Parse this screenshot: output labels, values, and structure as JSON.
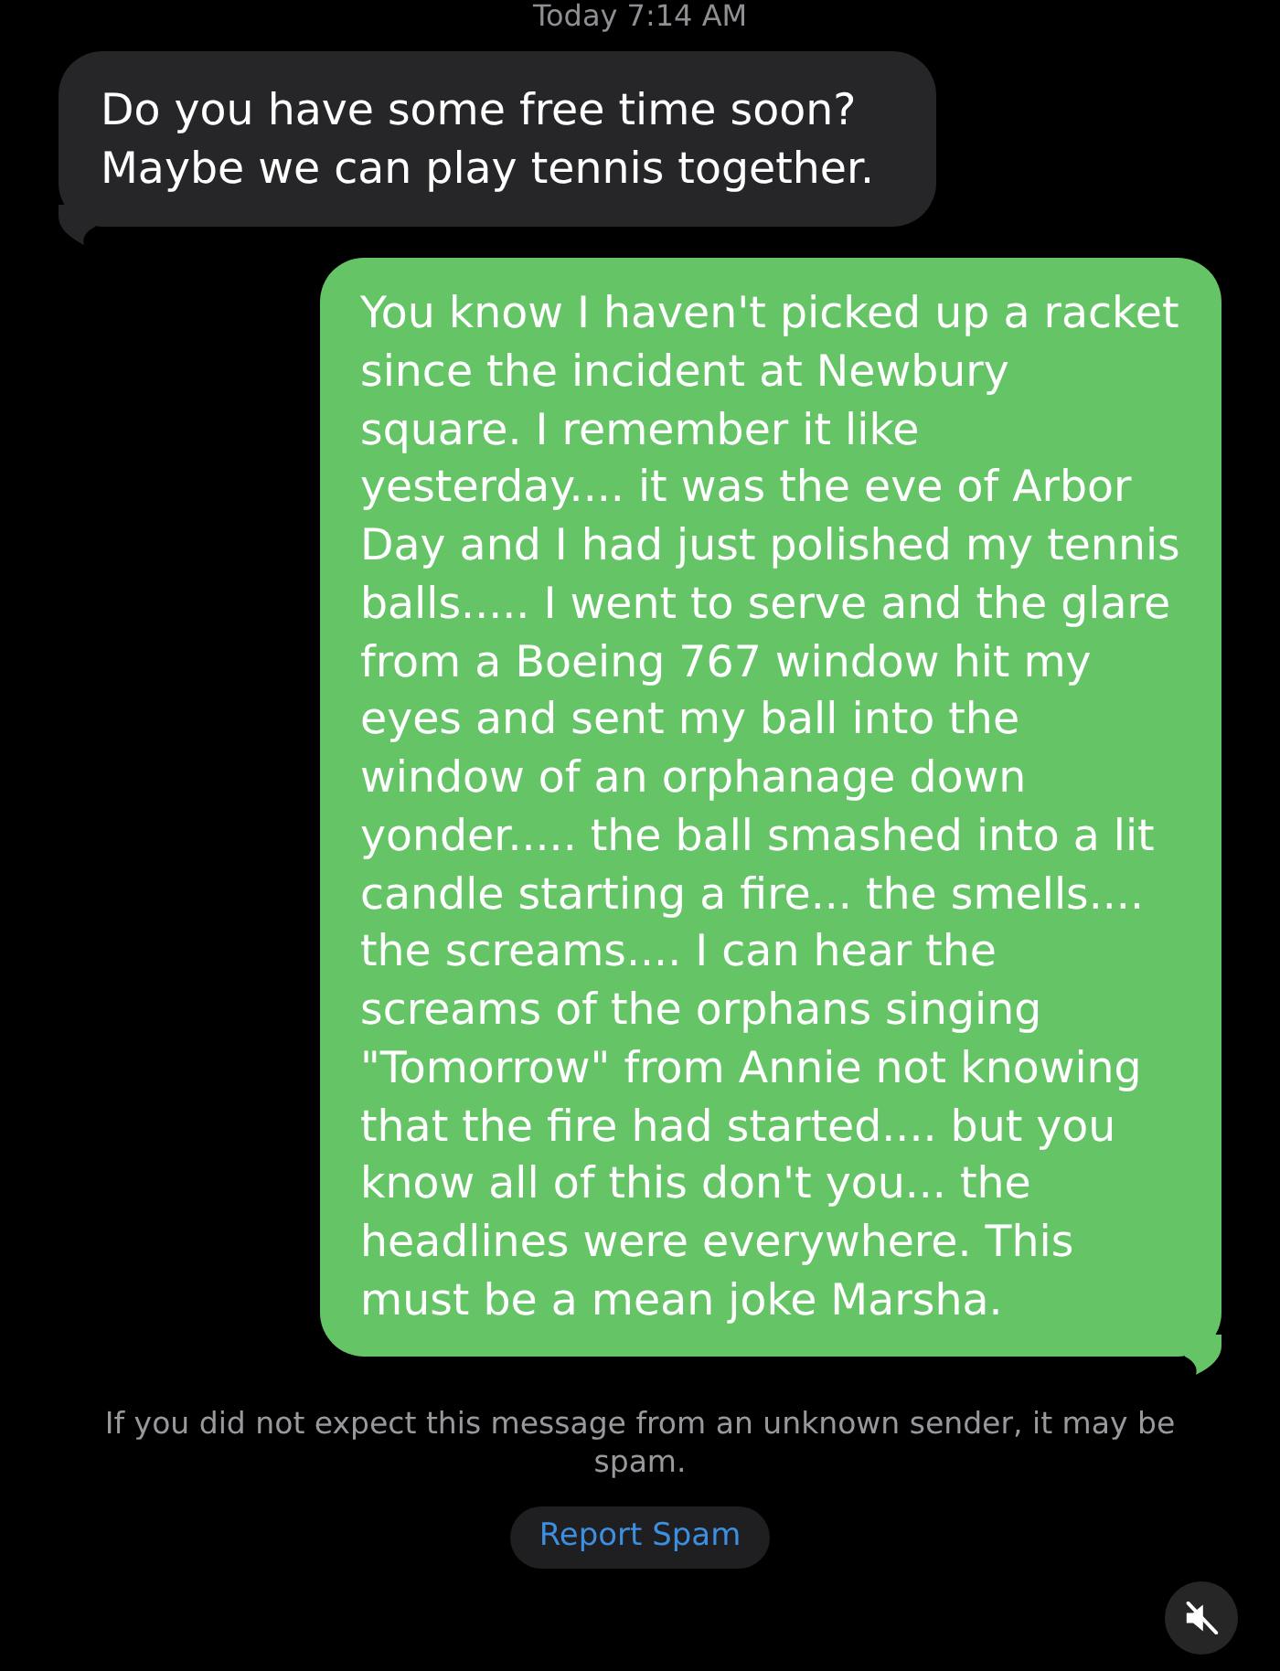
{
  "timestamp": "Today 7:14 AM",
  "messages": [
    {
      "kind": "received",
      "text": "Do you have some free time soon? Maybe we can play tennis together."
    },
    {
      "kind": "sent",
      "text": "You know I haven't picked up a racket since the incident at Newbury square. I remember it like yesterday.... it was the eve of Arbor Day and I had just polished my tennis balls..... I went to serve and the glare from a Boeing 767 window hit my eyes and sent my ball into the window of an orphanage down yonder..... the ball smashed into a lit candle starting a fire... the smells.... the screams.... I can hear the screams of the orphans singing \"Tomorrow\" from Annie not knowing that the fire had started.... but you know all of this don't you... the headlines were everywhere. This must be a mean joke Marsha."
    }
  ],
  "spam_notice": {
    "text": "If you did not expect this message from an unknown sender, it may be spam.",
    "button": "Report Spam"
  },
  "sound_button": {
    "muted": true
  }
}
